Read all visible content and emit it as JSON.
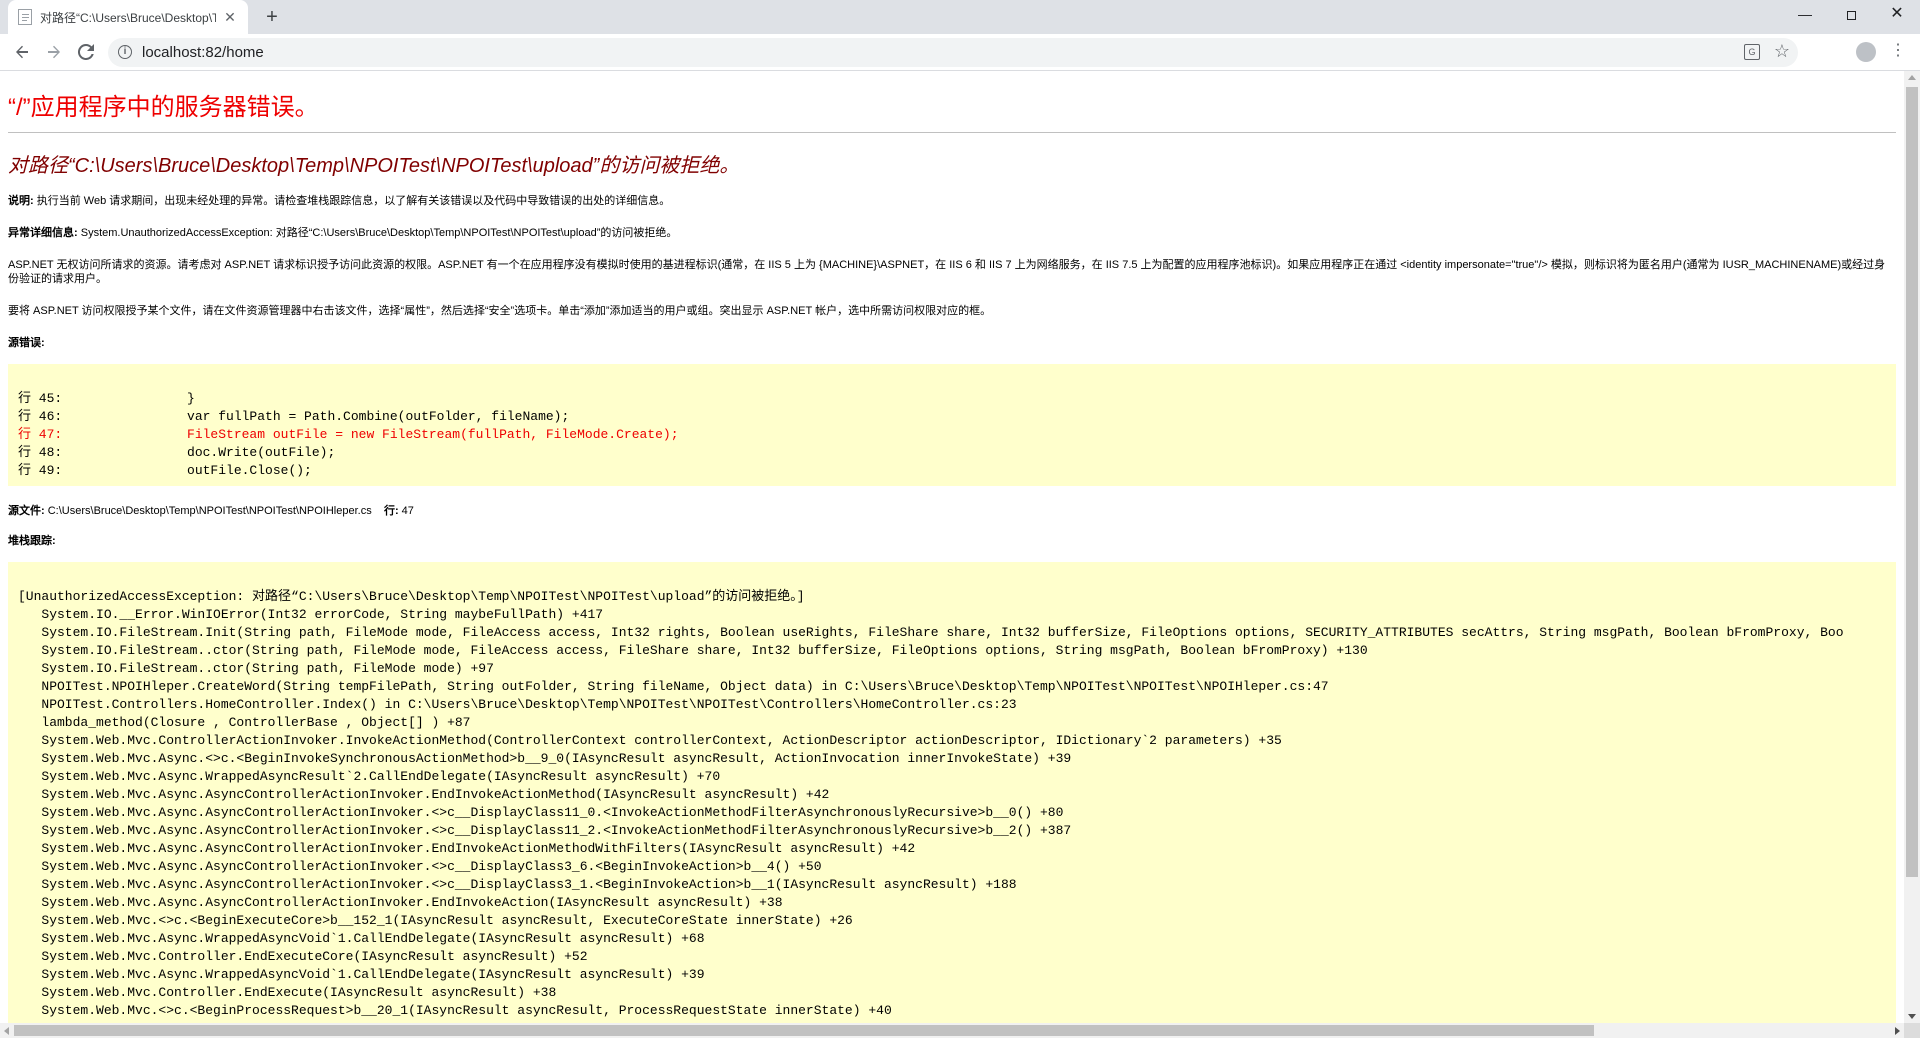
{
  "browser": {
    "tab_title": "对路径“C:\\Users\\Bruce\\Desktop\\Temp\\NPOITest\\NPOITest\\upload”的访问被拒绝。",
    "tab_close": "✕",
    "new_tab": "+",
    "url": "localhost:82/home",
    "window_min": "—",
    "window_close": "✕",
    "icons": [
      "page-icon",
      "back-icon",
      "forward-icon",
      "reload-icon",
      "info-icon",
      "translate-icon",
      "star-icon",
      "avatar",
      "kebab-menu-icon"
    ]
  },
  "page": {
    "title": "“/”应用程序中的服务器错误。",
    "error_heading": "对路径“C:\\Users\\Bruce\\Desktop\\Temp\\NPOITest\\NPOITest\\upload”的访问被拒绝。",
    "description_label": "说明:",
    "description_text": " 执行当前 Web 请求期间，出现未经处理的异常。请检查堆栈跟踪信息，以了解有关该错误以及代码中导致错误的出处的详细信息。",
    "exception_label": "异常详细信息:",
    "exception_text": " System.UnauthorizedAccessException: 对路径“C:\\Users\\Bruce\\Desktop\\Temp\\NPOITest\\NPOITest\\upload”的访问被拒绝。",
    "aspnet_text": "ASP.NET 无权访问所请求的资源。请考虑对 ASP.NET 请求标识授予访问此资源的权限。ASP.NET 有一个在应用程序没有模拟时使用的基进程标识(通常，在 IIS 5 上为 {MACHINE}\\ASPNET，在 IIS 6 和 IIS 7 上为网络服务，在 IIS 7.5 上为配置的应用程序池标识)。如果应用程序正在通过 <identity impersonate=\"true\"/> 模拟，则标识将为匿名用户(通常为 IUSR_MACHINENAME)或经过身份验证的请求用户。",
    "grant_text": "要将 ASP.NET 访问权限授予某个文件，请在文件资源管理器中右击该文件，选择“属性”，然后选择“安全”选项卡。单击“添加”添加适当的用户或组。突出显示 ASP.NET 帐户，选中所需访问权限对应的框。",
    "source_error_label": "源错误:",
    "source_lines": {
      "l45": "行 45:                }",
      "l46": "行 46:                var fullPath = Path.Combine(outFolder, fileName);",
      "l47": "行 47:                FileStream outFile = new FileStream(fullPath, FileMode.Create);",
      "l48": "行 48:                doc.Write(outFile);",
      "l49": "行 49:                outFile.Close();"
    },
    "source_file_label": "源文件:",
    "source_file_path": " C:\\Users\\Bruce\\Desktop\\Temp\\NPOITest\\NPOITest\\NPOIHleper.cs",
    "line_label": "    行:",
    "line_number": " 47",
    "stack_label": "堆栈跟踪:",
    "stack_lines": [
      "[UnauthorizedAccessException: 对路径“C:\\Users\\Bruce\\Desktop\\Temp\\NPOITest\\NPOITest\\upload”的访问被拒绝。]",
      "   System.IO.__Error.WinIOError(Int32 errorCode, String maybeFullPath) +417",
      "   System.IO.FileStream.Init(String path, FileMode mode, FileAccess access, Int32 rights, Boolean useRights, FileShare share, Int32 bufferSize, FileOptions options, SECURITY_ATTRIBUTES secAttrs, String msgPath, Boolean bFromProxy, Boo",
      "   System.IO.FileStream..ctor(String path, FileMode mode, FileAccess access, FileShare share, Int32 bufferSize, FileOptions options, String msgPath, Boolean bFromProxy) +130",
      "   System.IO.FileStream..ctor(String path, FileMode mode) +97",
      "   NPOITest.NPOIHleper.CreateWord(String tempFilePath, String outFolder, String fileName, Object data) in C:\\Users\\Bruce\\Desktop\\Temp\\NPOITest\\NPOITest\\NPOIHleper.cs:47",
      "   NPOITest.Controllers.HomeController.Index() in C:\\Users\\Bruce\\Desktop\\Temp\\NPOITest\\NPOITest\\Controllers\\HomeController.cs:23",
      "   lambda_method(Closure , ControllerBase , Object[] ) +87",
      "   System.Web.Mvc.ControllerActionInvoker.InvokeActionMethod(ControllerContext controllerContext, ActionDescriptor actionDescriptor, IDictionary`2 parameters) +35",
      "   System.Web.Mvc.Async.<>c.<BeginInvokeSynchronousActionMethod>b__9_0(IAsyncResult asyncResult, ActionInvocation innerInvokeState) +39",
      "   System.Web.Mvc.Async.WrappedAsyncResult`2.CallEndDelegate(IAsyncResult asyncResult) +70",
      "   System.Web.Mvc.Async.AsyncControllerActionInvoker.EndInvokeActionMethod(IAsyncResult asyncResult) +42",
      "   System.Web.Mvc.Async.AsyncControllerActionInvoker.<>c__DisplayClass11_0.<InvokeActionMethodFilterAsynchronouslyRecursive>b__0() +80",
      "   System.Web.Mvc.Async.AsyncControllerActionInvoker.<>c__DisplayClass11_2.<InvokeActionMethodFilterAsynchronouslyRecursive>b__2() +387",
      "   System.Web.Mvc.Async.AsyncControllerActionInvoker.EndInvokeActionMethodWithFilters(IAsyncResult asyncResult) +42",
      "   System.Web.Mvc.Async.AsyncControllerActionInvoker.<>c__DisplayClass3_6.<BeginInvokeAction>b__4() +50",
      "   System.Web.Mvc.Async.AsyncControllerActionInvoker.<>c__DisplayClass3_1.<BeginInvokeAction>b__1(IAsyncResult asyncResult) +188",
      "   System.Web.Mvc.Async.AsyncControllerActionInvoker.EndInvokeAction(IAsyncResult asyncResult) +38",
      "   System.Web.Mvc.<>c.<BeginExecuteCore>b__152_1(IAsyncResult asyncResult, ExecuteCoreState innerState) +26",
      "   System.Web.Mvc.Async.WrappedAsyncVoid`1.CallEndDelegate(IAsyncResult asyncResult) +68",
      "   System.Web.Mvc.Controller.EndExecuteCore(IAsyncResult asyncResult) +52",
      "   System.Web.Mvc.Async.WrappedAsyncVoid`1.CallEndDelegate(IAsyncResult asyncResult) +39",
      "   System.Web.Mvc.Controller.EndExecute(IAsyncResult asyncResult) +38",
      "   System.Web.Mvc.<>c.<BeginProcessRequest>b__20_1(IAsyncResult asyncResult, ProcessRequestState innerState) +40"
    ]
  },
  "colors": {
    "title_red": "#ee0000",
    "heading_maroon": "#800000",
    "code_background": "#ffffcc"
  }
}
